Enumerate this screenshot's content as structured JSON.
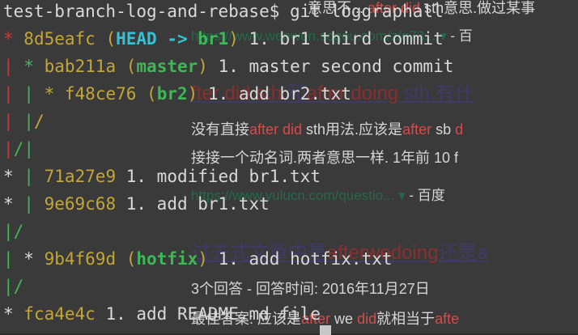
{
  "background_page": {
    "url1": "https://www.wenwen.sogou.com/z/q73...",
    "url1_tail": "- 百",
    "heading1_a": "fter did sth.",
    "heading1_b": "和",
    "heading1_c": "after doing",
    "heading1_d": " sth.有什",
    "body1_a": "没有直接",
    "body1_b": "after did",
    "body1_c": " sth用法.应该是",
    "body1_d": "after",
    "body1_e": " sb ",
    "body1_f": "d",
    "body2": "接接一个动名词.两者意思一样. 1年前 10 f",
    "url2": "https://www.yulucn.com/questio...",
    "url2_tail": "- 百度",
    "heading2_a": "过去式文章中是",
    "heading2_b": "afterwedoing",
    "heading2_c": "还是a",
    "body3": "3个回答 - 回答时间: 2016年11月27日",
    "body4_a": "最佳答案: 应该是",
    "body4_b": "after",
    "body4_c": " we ",
    "body4_d": "did",
    "body4_e": "就相当于",
    "body4_f": "afte",
    "top_cut_a": "意思不... ",
    "top_cut_b": "after did",
    "top_cut_c": " sth意思.做过某事"
  },
  "terminal": {
    "prompt": "test-branch-log-and-rebase$ ",
    "command": "git loggraphall",
    "lines": [
      {
        "g1": "* ",
        "hash": "8d5eafc",
        "ref_open": " (",
        "head": "HEAD -> ",
        "branch": "br1",
        "ref_close": ")",
        "msg": " 1. br1 third commit"
      },
      {
        "g1": "| ",
        "g2": "* ",
        "hash": "bab211a",
        "ref_open": " (",
        "branch": "master",
        "ref_close": ")",
        "msg": " 1. master second commit"
      },
      {
        "g1": "| ",
        "g2": "| ",
        "g3": "* ",
        "hash": "f48ce76",
        "ref_open": " (",
        "branch": "br2",
        "ref_close": ")",
        "msg": " 1. add br2.txt"
      },
      {
        "g1": "| ",
        "g2": "|",
        "g3": "/"
      },
      {
        "g1": "|",
        "g2": "/",
        "g3": "|"
      },
      {
        "g1": "* ",
        "g2": "| ",
        "hash": "71a27e9",
        "msg": " 1. modified br1.txt"
      },
      {
        "g1": "* ",
        "g2": "| ",
        "hash": "9e69c68",
        "msg": " 1. add br1.txt"
      },
      {
        "g1": "|",
        "g2": "/"
      },
      {
        "g1": "| ",
        "g2": "* ",
        "hash": "9b4f69d",
        "ref_open": " (",
        "branch": "hotfix",
        "ref_close": ")",
        "msg": " 1. add hotfix.txt"
      },
      {
        "g1": "|",
        "g2": "/"
      },
      {
        "g1": "* ",
        "hash": "fca4e4c",
        "msg": " 1. add README.md file"
      }
    ]
  }
}
